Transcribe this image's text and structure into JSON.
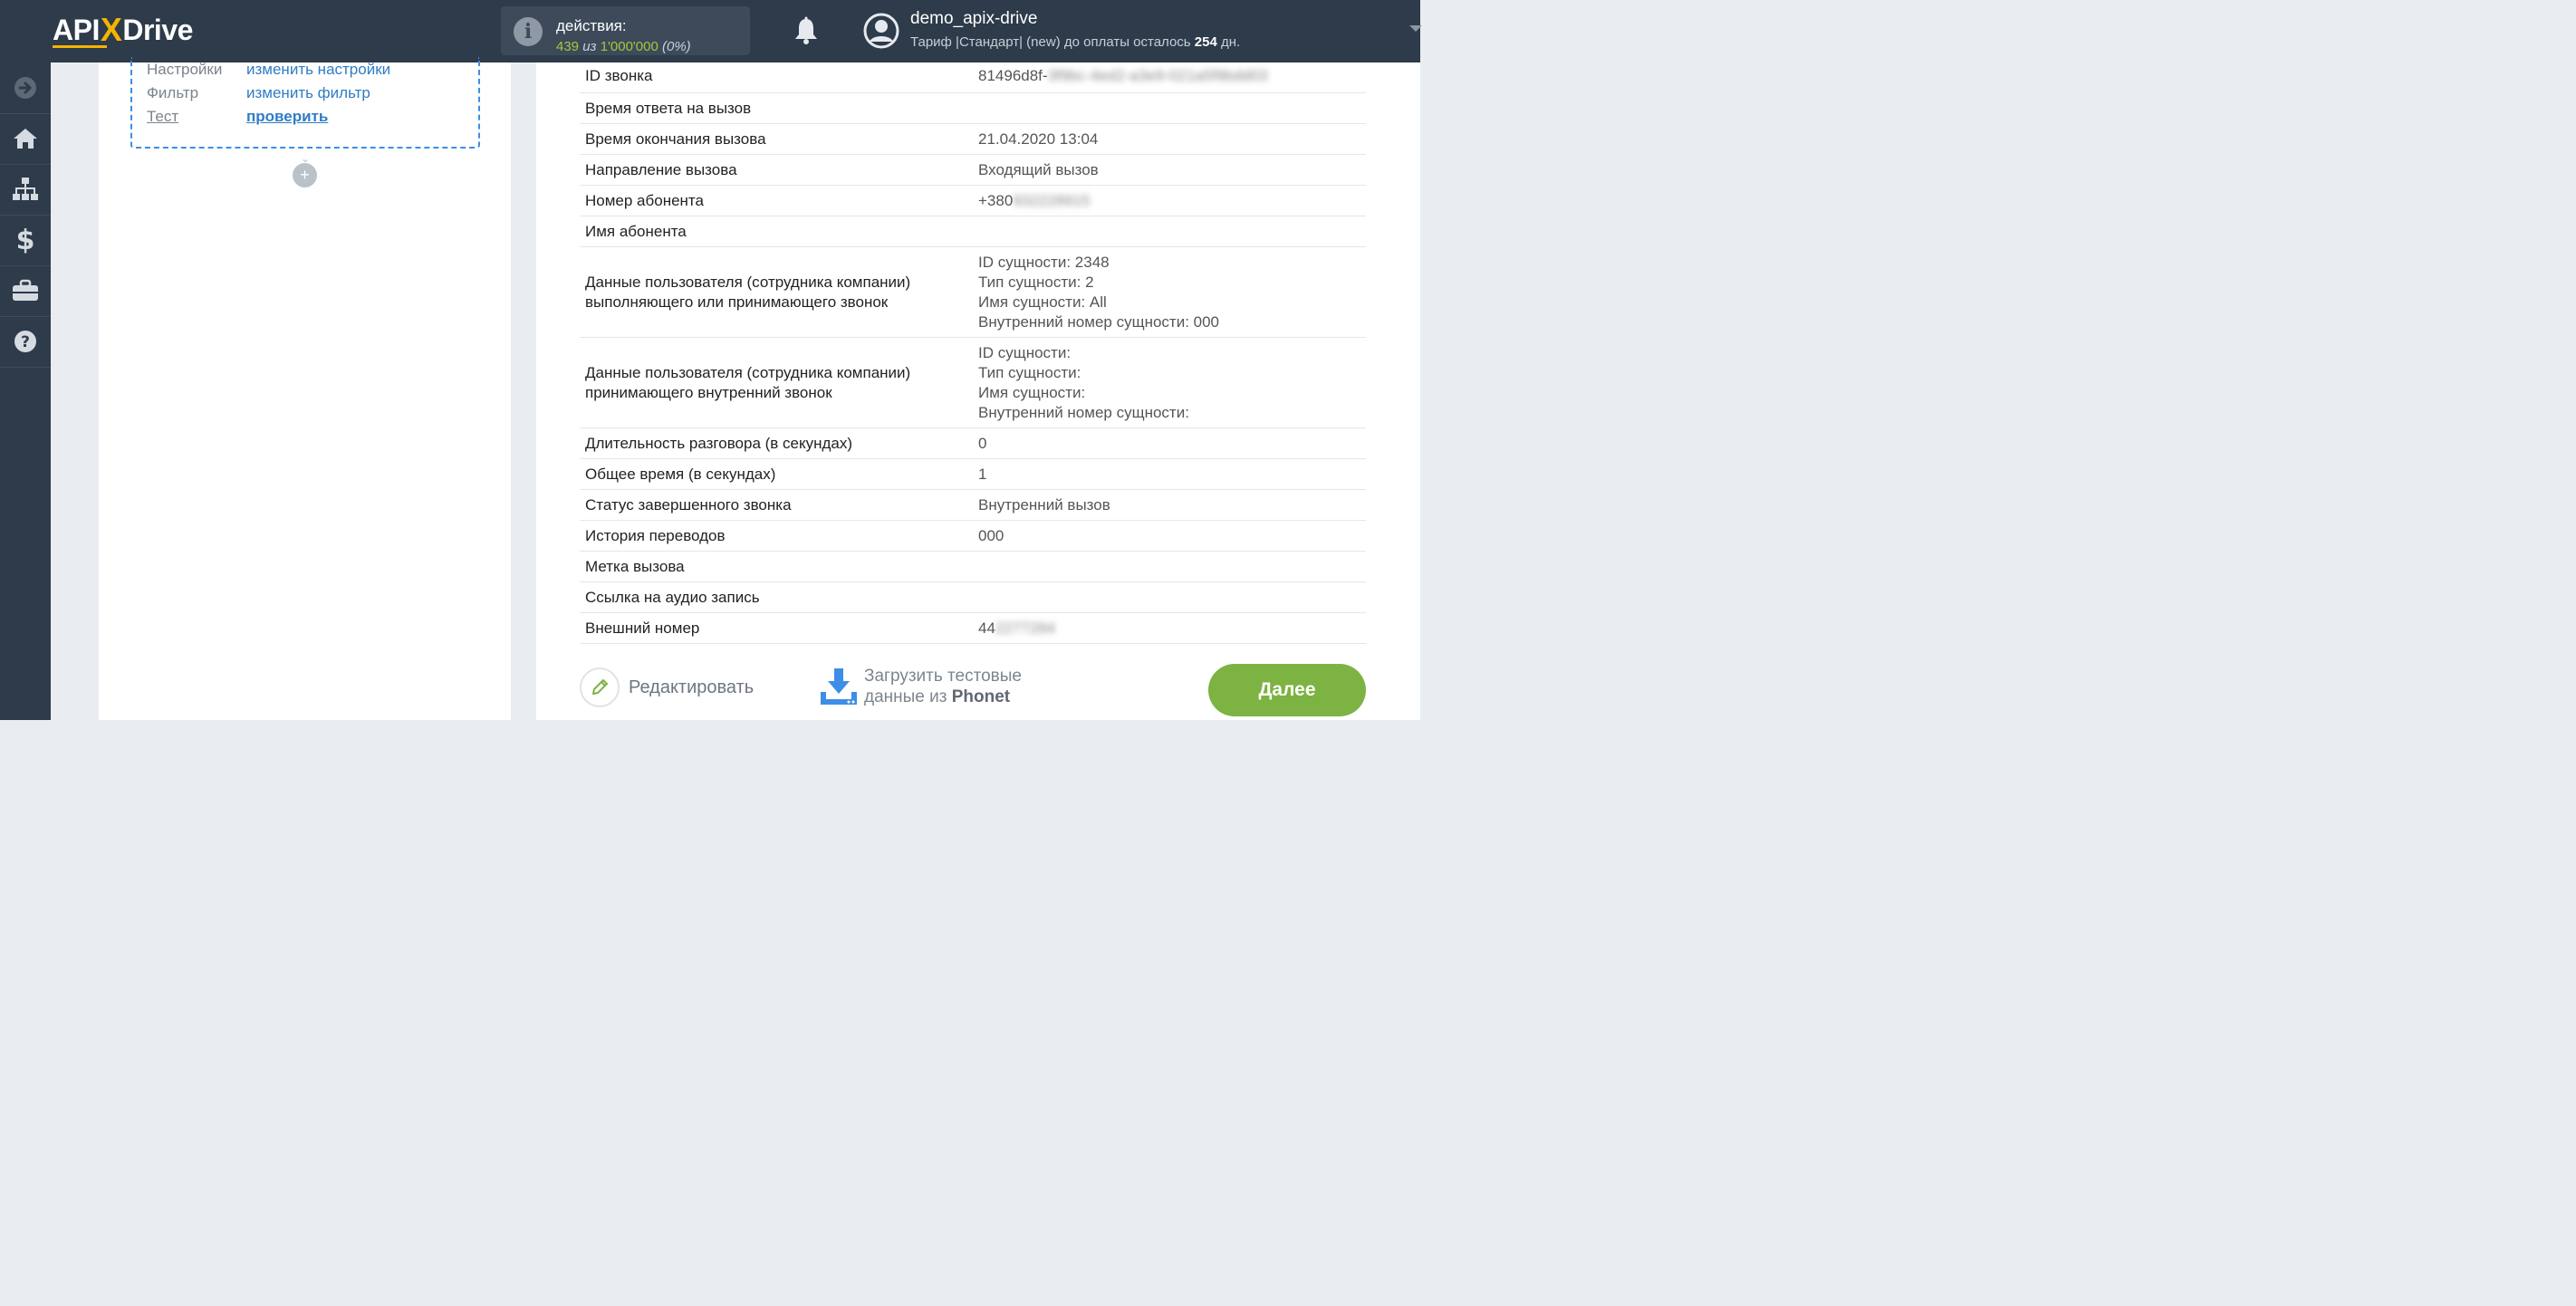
{
  "header": {
    "logo": {
      "api": "API",
      "x": "X",
      "drive": "Drive"
    },
    "actions": {
      "label": "действия:",
      "used": "439",
      "of": "из",
      "total": "1'000'000",
      "percent": "(0%)"
    },
    "user": {
      "name": "demo_apix-drive",
      "tariff_prefix": "Тариф |Стандарт| (new) до оплаты осталось",
      "days": "254",
      "days_suffix": "дн."
    }
  },
  "sidebar": {
    "items": [
      "arrow-right-icon",
      "home-icon",
      "sitemap-icon",
      "dollar-icon",
      "briefcase-icon",
      "help-icon"
    ]
  },
  "config": {
    "rows": [
      {
        "key": "Настройки",
        "value": "изменить настройки"
      },
      {
        "key": "Фильтр",
        "value": "изменить фильтр"
      },
      {
        "key": "Тест",
        "value": "проверить"
      }
    ]
  },
  "data_table": {
    "rows": [
      {
        "key": "ID звонка",
        "value": "81496d8f-",
        "hidden": "3f9bc-4ed2-a3e9-021a5f9bdd03"
      },
      {
        "key": "Время ответа на вызов",
        "value": ""
      },
      {
        "key": "Время окончания вызова",
        "value": "21.04.2020 13:04"
      },
      {
        "key": "Направление вызова",
        "value": "Входящий вызов"
      },
      {
        "key": "Номер абонента",
        "value": "+380",
        "hidden": "932228915"
      },
      {
        "key": "Имя абонента",
        "value": ""
      },
      {
        "key_lines": [
          "Данные пользователя (сотрудника компании)",
          "выполняющего или принимающего звонок"
        ],
        "value_lines": [
          "ID сущности: 2348",
          "Тип сущности: 2",
          "Имя сущности: All",
          "Внутренний номер сущности: 000"
        ]
      },
      {
        "key_lines": [
          "Данные пользователя (сотрудника компании)",
          "принимающего внутренний звонок"
        ],
        "value_lines": [
          "ID сущности:",
          "Тип сущности:",
          "Имя сущности:",
          "Внутренний номер сущности:"
        ]
      },
      {
        "key": "Длительность разговора (в секундах)",
        "value": "0"
      },
      {
        "key": "Общее время (в секундах)",
        "value": "1"
      },
      {
        "key": "Статус завершенного звонка",
        "value": "Внутренний вызов"
      },
      {
        "key": "История переводов",
        "value": "000"
      },
      {
        "key": "Метка вызова",
        "value": ""
      },
      {
        "key": "Ссылка на аудио запись",
        "value": ""
      },
      {
        "key": "Внешний номер",
        "value": "44",
        "hidden": "2277284"
      }
    ]
  },
  "footer": {
    "edit_label": "Редактировать",
    "load_line1": "Загрузить тестовые",
    "load_line2_prefix": "данные из",
    "load_service": "Phonet",
    "next_label": "Далее"
  },
  "colors": {
    "topbar": "#2d3b4b",
    "accent_link": "#2f7cc5",
    "next_button": "#7cb342",
    "actions_count": "#a7c83a",
    "logo_x": "#f5b400"
  }
}
